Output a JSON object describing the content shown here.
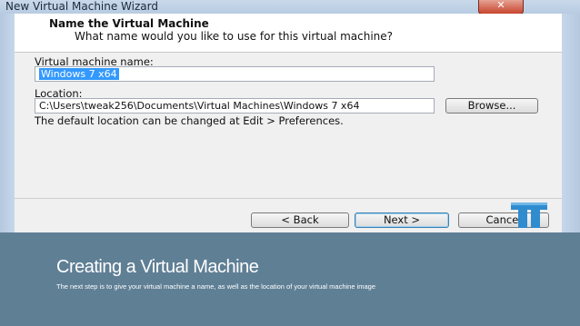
{
  "window": {
    "title": "New Virtual Machine Wizard",
    "close_glyph": "✕"
  },
  "header": {
    "title": "Name the Virtual Machine",
    "subtitle": "What name would you like to use for this virtual machine?"
  },
  "form": {
    "vm_name_label": "Virtual machine name:",
    "vm_name_value": "Windows 7 x64",
    "location_label": "Location:",
    "location_value": "C:\\Users\\tweak256\\Documents\\Virtual Machines\\Windows 7 x64",
    "browse_label": "Browse...",
    "hint": "The default location can be changed at Edit > Preferences."
  },
  "footer": {
    "back_label": "< Back",
    "next_label": "Next >",
    "cancel_label": "Cancel"
  },
  "slide": {
    "title": "Creating a Virtual Machine",
    "subtitle": "The next step is to give your virtual machine a name, as well as the location of your virtual machine image",
    "band_color": "#5f7f95"
  },
  "icons": {
    "logo": "tweaktown-logo-icon"
  }
}
